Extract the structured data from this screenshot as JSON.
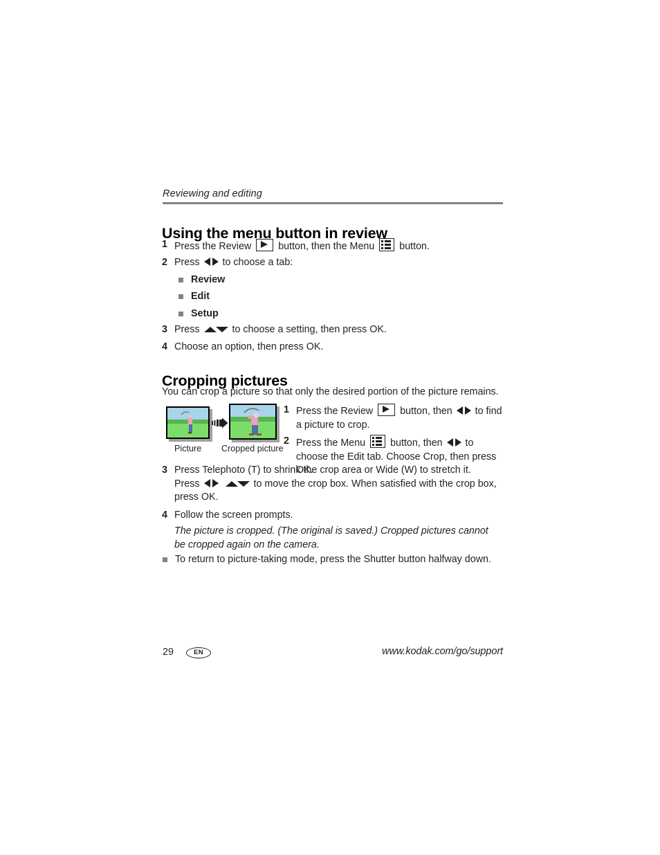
{
  "document": {
    "running_header": "Reviewing and editing",
    "page_number": "29",
    "language_badge": "EN",
    "footer_url": "www.kodak.com/go/support"
  },
  "section_menu_button": {
    "heading": "Using the menu button in review",
    "steps": [
      {
        "num": "1",
        "parts": [
          {
            "type": "text",
            "value": "Press the Review "
          },
          {
            "type": "icon",
            "value": "review-play-icon"
          },
          {
            "type": "text",
            "value": " button, then the Menu "
          },
          {
            "type": "icon",
            "value": "menu-list-icon"
          },
          {
            "type": "text",
            "value": " button."
          }
        ],
        "text": "Press the Review  button, then the Menu  button."
      },
      {
        "num": "2",
        "parts": [
          {
            "type": "text",
            "value": "Press "
          },
          {
            "type": "icon",
            "value": "left-right-arrows-icon"
          },
          {
            "type": "text",
            "value": " to choose a tab:"
          }
        ],
        "text": "Press  to choose a tab:"
      },
      {
        "num": "3",
        "parts": [
          {
            "type": "text",
            "value": "Press "
          },
          {
            "type": "icon",
            "value": "up-down-arrows-icon"
          },
          {
            "type": "text",
            "value": " to choose a setting, then press OK."
          }
        ],
        "text": "Press  to choose a setting, then press OK."
      },
      {
        "num": "4",
        "parts": [
          {
            "type": "text",
            "value": "Choose an option, then press OK."
          }
        ],
        "text": "Choose an option, then press OK."
      }
    ],
    "tabs": [
      {
        "label": "Review"
      },
      {
        "label": "Edit"
      },
      {
        "label": "Setup"
      }
    ],
    "step1_pre": "Press the Review ",
    "step1_mid": " button, then the Menu ",
    "step1_post": " button.",
    "step2_pre": "Press ",
    "step2_post": " to choose a tab:",
    "step3_pre": "Press ",
    "step3_post": " to choose a setting, then press OK.",
    "step4": "Choose an option, then press OK."
  },
  "section_cropping": {
    "heading": "Cropping pictures",
    "intro": "You can crop a picture so that only the desired portion of the picture remains.",
    "figure": {
      "caption_left": "Picture",
      "caption_right": "Cropped picture",
      "arrow": "right-arrow-icon",
      "image_description": "golfer swinging a club on green grass under blue sky"
    },
    "step1": {
      "num": "1",
      "pre": "Press the Review ",
      "mid": " button, then ",
      "post": " to find a picture to crop."
    },
    "step2": {
      "num": "2",
      "pre": "Press the Menu ",
      "mid": " button, then ",
      "post": " to choose the Edit tab. Choose Crop, then press OK."
    },
    "step3": {
      "num": "3",
      "line1": "Press Telephoto (T) to shrink the crop area or Wide (W) to stretch it.",
      "line2_pre": "Press ",
      "line2_post": " to move the crop box. When satisfied with the crop box, press OK."
    },
    "step4": {
      "num": "4",
      "text": "Follow the screen prompts.",
      "note": "The picture is cropped. (The original is saved.) Cropped pictures cannot be cropped again on the camera."
    },
    "final_bullet": "To return to picture-taking mode, press the Shutter button halfway down."
  },
  "colors": {
    "text": "#231f20",
    "rule": "#808285",
    "bullet": "#808285",
    "sky": "#a8d4ea",
    "grass_far": "#5dbb5a",
    "grass_near": "#7ddb6a",
    "shirt": "#f0a0c0",
    "pants": "#4f6fa8"
  }
}
